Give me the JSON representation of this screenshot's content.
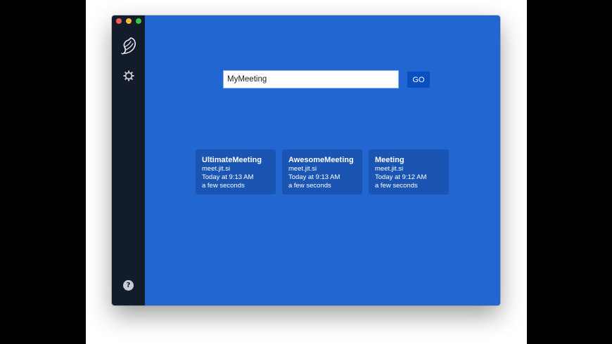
{
  "room": {
    "input_value": "MyMeeting",
    "go_label": "GO"
  },
  "sidebar": {
    "logo_icon": "jitsi-logo-icon",
    "settings_icon": "gear-icon",
    "help_glyph": "?"
  },
  "recent_meetings": [
    {
      "name": "UltimateMeeting",
      "server": "meet.jit.si",
      "date": "Today at 9:13 AM",
      "duration": "a few seconds"
    },
    {
      "name": "AwesomeMeeting",
      "server": "meet.jit.si",
      "date": "Today at 9:13 AM",
      "duration": "a few seconds"
    },
    {
      "name": "Meeting",
      "server": "meet.jit.si",
      "date": "Today at 9:12 AM",
      "duration": "a few seconds"
    }
  ],
  "colors": {
    "sidebar_bg": "#131c2b",
    "main_bg": "#2266d2",
    "card_bg": "#1a55b4",
    "button_bg": "#0a4fc0"
  }
}
